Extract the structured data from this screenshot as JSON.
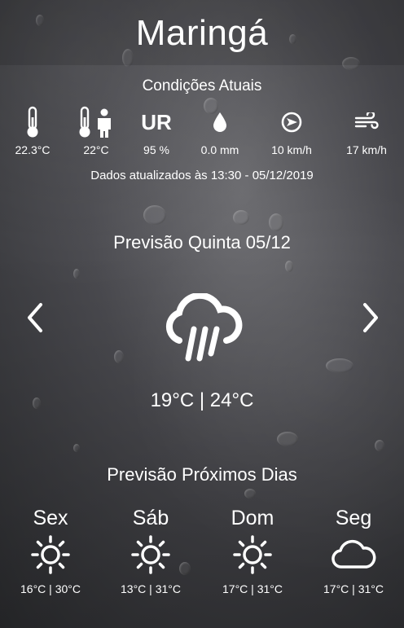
{
  "city": "Maringá",
  "current": {
    "title": "Condições Atuais",
    "temperature": "22.3°C",
    "feels_like": "22°C",
    "humidity_label": "UR",
    "humidity": "95 %",
    "precipitation": "0.0 mm",
    "wind_speed": "10 km/h",
    "gust": "17 km/h",
    "updated": "Dados atualizados às 13:30 - 05/12/2019"
  },
  "forecast": {
    "title": "Previsão Quinta 05/12",
    "icon": "cloud-rain-icon",
    "range": "19°C | 24°C"
  },
  "next_days": {
    "title": "Previsão Próximos Dias",
    "days": [
      {
        "name": "Sex",
        "icon": "sun-icon",
        "range": "16°C | 30°C"
      },
      {
        "name": "Sáb",
        "icon": "sun-icon",
        "range": "13°C | 31°C"
      },
      {
        "name": "Dom",
        "icon": "sun-icon",
        "range": "17°C | 31°C"
      },
      {
        "name": "Seg",
        "icon": "cloud-icon",
        "range": "17°C | 31°C"
      }
    ]
  }
}
